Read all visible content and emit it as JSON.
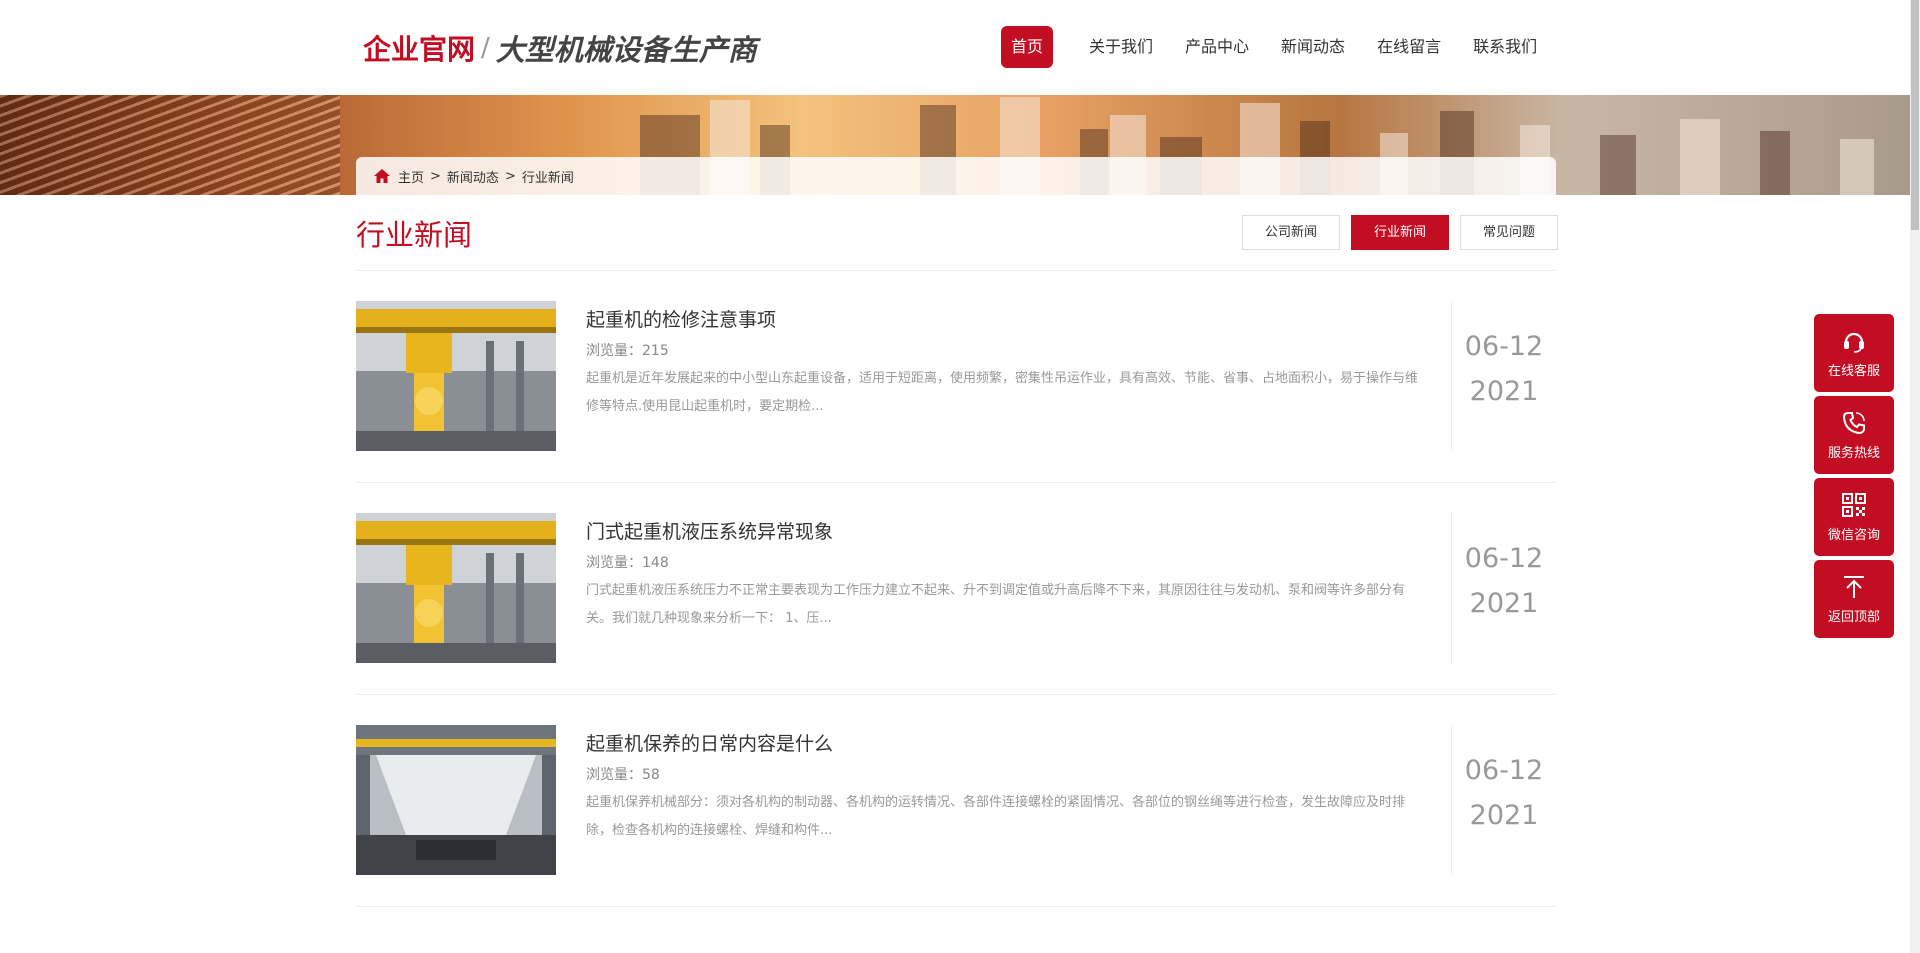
{
  "header": {
    "logo_brand": "企业官网",
    "logo_separator": "/",
    "logo_slogan": "大型机械设备生产商",
    "nav": [
      {
        "label": "首页",
        "active": true
      },
      {
        "label": "关于我们"
      },
      {
        "label": "产品中心"
      },
      {
        "label": "新闻动态"
      },
      {
        "label": "在线留言"
      },
      {
        "label": "联系我们"
      }
    ]
  },
  "breadcrumb": {
    "home_icon": "home-icon",
    "items": [
      "主页",
      "新闻动态",
      "行业新闻"
    ],
    "separator": ">"
  },
  "page": {
    "title": "行业新闻",
    "tabs": [
      {
        "label": "公司新闻"
      },
      {
        "label": "行业新闻",
        "active": true
      },
      {
        "label": "常见问题"
      }
    ]
  },
  "news": [
    {
      "title": "起重机的检修注意事项",
      "views_label": "浏览量：",
      "views": "215",
      "desc": "起重机是近年发展起来的中小型山东起重设备，适用于短距离，使用频繁，密集性吊运作业，具有高效、节能、省事、占地面积小，易于操作与维修等特点.使用昆山起重机时，要定期检...",
      "date_md": "06-12",
      "date_y": "2021"
    },
    {
      "title": "门式起重机液压系统异常现象",
      "views_label": "浏览量：",
      "views": "148",
      "desc": "门式起重机液压系统压力不正常主要表现为工作压力建立不起来、升不到调定值或升高后降不下来，其原因往往与发动机、泵和阀等许多部分有关。我们就几种现象来分析一下： 1、压...",
      "date_md": "06-12",
      "date_y": "2021"
    },
    {
      "title": "起重机保养的日常内容是什么",
      "views_label": "浏览量：",
      "views": "58",
      "desc": "起重机保养机械部分：须对各机构的制动器、各机构的运转情况、各部件连接螺栓的紧固情况、各部位的钢丝绳等进行检查，发生故障应及时排除，检查各机构的连接螺栓、焊缝和构件...",
      "date_md": "06-12",
      "date_y": "2021"
    }
  ],
  "side_toolbar": [
    {
      "label": "在线客服",
      "icon": "headset-icon"
    },
    {
      "label": "服务热线",
      "icon": "phone-icon"
    },
    {
      "label": "微信咨询",
      "icon": "qrcode-icon"
    },
    {
      "label": "返回顶部",
      "icon": "arrow-up-icon"
    }
  ],
  "colors": {
    "accent": "#c30d23",
    "text": "#333333",
    "muted": "#999999"
  }
}
